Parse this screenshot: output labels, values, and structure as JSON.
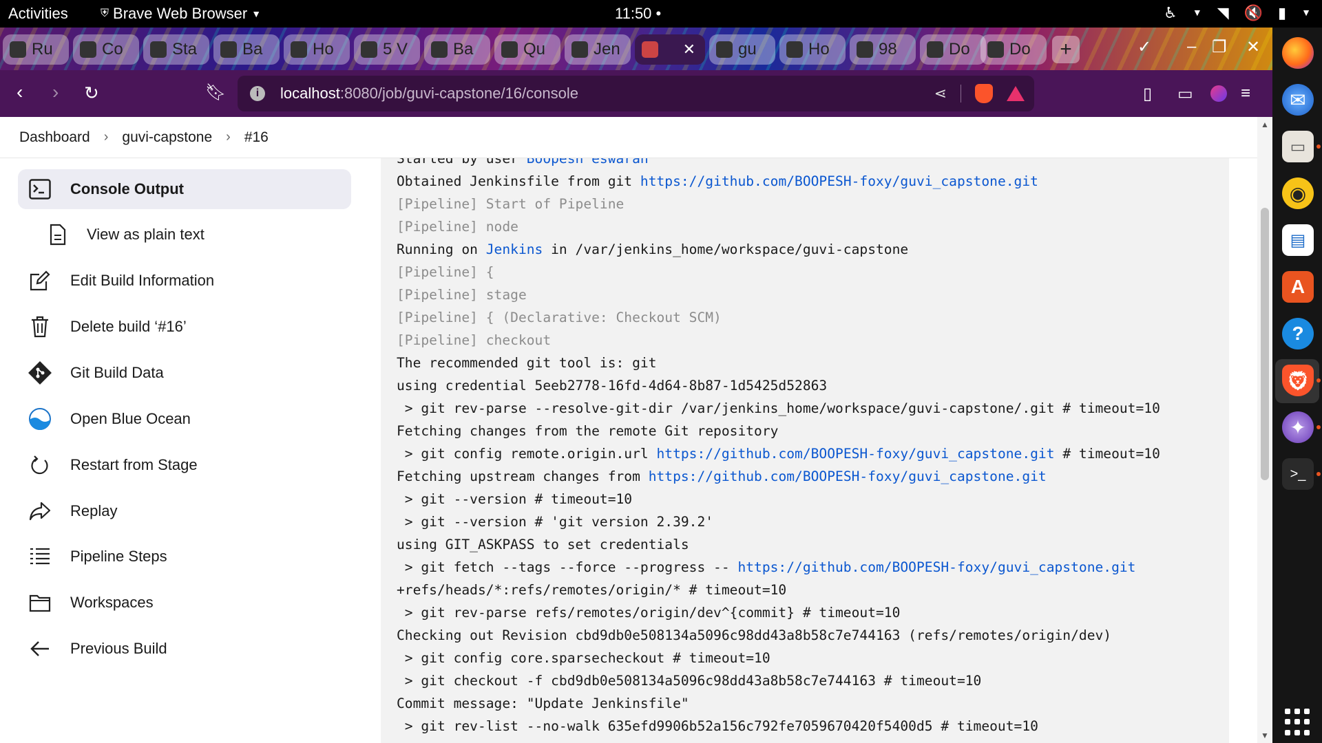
{
  "topbar": {
    "activities": "Activities",
    "app_name": "Brave Web Browser",
    "clock": "11:50",
    "clock_dot": "•"
  },
  "tabs": [
    {
      "label": "Ru"
    },
    {
      "label": "Co"
    },
    {
      "label": "Sta"
    },
    {
      "label": "Ba"
    },
    {
      "label": "Ho"
    },
    {
      "label": "5 V"
    },
    {
      "label": "Ba"
    },
    {
      "label": "Qu"
    },
    {
      "label": "Jen"
    },
    {
      "label": ""
    },
    {
      "label": "gu"
    },
    {
      "label": "Ho"
    },
    {
      "label": "98"
    },
    {
      "label": "Do"
    },
    {
      "label": "Do"
    }
  ],
  "url": {
    "host": "localhost",
    "path": ":8080/job/guvi-capstone/16/console"
  },
  "breadcrumb": [
    "Dashboard",
    "guvi-capstone",
    "#16"
  ],
  "sidebar": [
    {
      "label": "Console Output",
      "icon": "terminal-icon"
    },
    {
      "label": "View as plain text",
      "icon": "document-icon"
    },
    {
      "label": "Edit Build Information",
      "icon": "edit-icon"
    },
    {
      "label": "Delete build ‘#16’",
      "icon": "trash-icon"
    },
    {
      "label": "Git Build Data",
      "icon": "git-icon"
    },
    {
      "label": "Open Blue Ocean",
      "icon": "blue-ocean-icon"
    },
    {
      "label": "Restart from Stage",
      "icon": "restart-icon"
    },
    {
      "label": "Replay",
      "icon": "replay-icon"
    },
    {
      "label": "Pipeline Steps",
      "icon": "list-icon"
    },
    {
      "label": "Workspaces",
      "icon": "folder-icon"
    },
    {
      "label": "Previous Build",
      "icon": "arrow-left-icon"
    }
  ],
  "console": {
    "lines": [
      {
        "segments": [
          {
            "text": "Started by user "
          },
          {
            "text": "Boopesh eswaran",
            "link": true
          }
        ]
      },
      {
        "segments": [
          {
            "text": "Obtained Jenkinsfile from git "
          },
          {
            "text": "https://github.com/BOOPESH-foxy/guvi_capstone.git",
            "link": true
          }
        ]
      },
      {
        "pipe": true,
        "segments": [
          {
            "text": "[Pipeline] Start of Pipeline"
          }
        ]
      },
      {
        "pipe": true,
        "segments": [
          {
            "text": "[Pipeline] node"
          }
        ]
      },
      {
        "segments": [
          {
            "text": "Running on "
          },
          {
            "text": "Jenkins",
            "link": true
          },
          {
            "text": " in /var/jenkins_home/workspace/guvi-capstone"
          }
        ]
      },
      {
        "pipe": true,
        "segments": [
          {
            "text": "[Pipeline] {"
          }
        ]
      },
      {
        "pipe": true,
        "segments": [
          {
            "text": "[Pipeline] stage"
          }
        ]
      },
      {
        "pipe": true,
        "segments": [
          {
            "text": "[Pipeline] { (Declarative: Checkout SCM)"
          }
        ]
      },
      {
        "pipe": true,
        "segments": [
          {
            "text": "[Pipeline] checkout"
          }
        ]
      },
      {
        "segments": [
          {
            "text": "The recommended git tool is: git"
          }
        ]
      },
      {
        "segments": [
          {
            "text": "using credential 5eeb2778-16fd-4d64-8b87-1d5425d52863"
          }
        ]
      },
      {
        "segments": [
          {
            "text": " > git rev-parse --resolve-git-dir /var/jenkins_home/workspace/guvi-capstone/.git # timeout=10"
          }
        ]
      },
      {
        "segments": [
          {
            "text": "Fetching changes from the remote Git repository"
          }
        ]
      },
      {
        "segments": [
          {
            "text": " > git config remote.origin.url "
          },
          {
            "text": "https://github.com/BOOPESH-foxy/guvi_capstone.git",
            "link": true
          },
          {
            "text": " # timeout=10"
          }
        ]
      },
      {
        "segments": [
          {
            "text": "Fetching upstream changes from "
          },
          {
            "text": "https://github.com/BOOPESH-foxy/guvi_capstone.git",
            "link": true
          }
        ]
      },
      {
        "segments": [
          {
            "text": " > git --version # timeout=10"
          }
        ]
      },
      {
        "segments": [
          {
            "text": " > git --version # 'git version 2.39.2'"
          }
        ]
      },
      {
        "segments": [
          {
            "text": "using GIT_ASKPASS to set credentials"
          }
        ]
      },
      {
        "segments": [
          {
            "text": " > git fetch --tags --force --progress -- "
          },
          {
            "text": "https://github.com/BOOPESH-foxy/guvi_capstone.git",
            "link": true
          }
        ]
      },
      {
        "segments": [
          {
            "text": "+refs/heads/*:refs/remotes/origin/* # timeout=10"
          }
        ]
      },
      {
        "segments": [
          {
            "text": " > git rev-parse refs/remotes/origin/dev^{commit} # timeout=10"
          }
        ]
      },
      {
        "segments": [
          {
            "text": "Checking out Revision cbd9db0e508134a5096c98dd43a8b58c7e744163 (refs/remotes/origin/dev)"
          }
        ]
      },
      {
        "segments": [
          {
            "text": " > git config core.sparsecheckout # timeout=10"
          }
        ]
      },
      {
        "segments": [
          {
            "text": " > git checkout -f cbd9db0e508134a5096c98dd43a8b58c7e744163 # timeout=10"
          }
        ]
      },
      {
        "segments": [
          {
            "text": "Commit message: \"Update Jenkinsfile\""
          }
        ]
      },
      {
        "segments": [
          {
            "text": " > git rev-list --no-walk 635efd9906b52a156c792fe7059670420f5400d5 # timeout=10"
          }
        ]
      }
    ]
  },
  "colors": {
    "link": "#0b57d0",
    "pipeline_text": "#8c8c8c",
    "browser_chrome": "#4a1558",
    "active_sidebar": "#ececf3"
  }
}
